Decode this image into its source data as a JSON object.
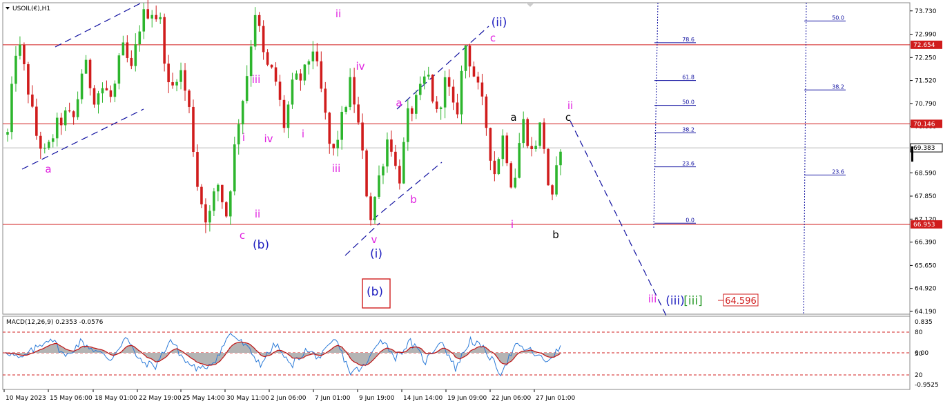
{
  "header": {
    "symbol_label": "USOIL(€),H1",
    "macd_label": "MACD(12,26,9) 0.2353 -0.0576"
  },
  "colors": {
    "bull": "#2db52d",
    "bear": "#d01c1c",
    "hline": "#d01c1c",
    "wave_magenta": "#e020e0",
    "wave_blue": "#2020c0",
    "wave_green": "#2a9a2a",
    "fib": "#1010a0",
    "macd_line": "#2a7ad8",
    "macd_signal": "#c01010",
    "macd_hist": "#b4b4b4"
  },
  "chart_data": [
    {
      "type": "candlestick",
      "title": "USOIL(€),H1",
      "x": [
        "10 May 2023",
        "15 May 06:00",
        "18 May 01:00",
        "22 May 19:00",
        "25 May 14:00",
        "30 May 11:00",
        "2 Jun 06:00",
        "7 Jun 01:00",
        "9 Jun 19:00",
        "14 Jun 14:00",
        "19 Jun 09:00",
        "22 Jun 06:00",
        "27 Jun 01:00"
      ],
      "ylim": [
        64.19,
        73.9
      ],
      "y_ticks": [
        "73.730",
        "72.990",
        "72.250",
        "71.520",
        "70.790",
        "70.060",
        "69.320",
        "68.590",
        "67.850",
        "67.120",
        "66.390",
        "65.650",
        "64.920",
        "64.190"
      ],
      "close_path": [
        69.8,
        72.9,
        71.5,
        69.8,
        69.1,
        70.0,
        70.4,
        70.3,
        72.2,
        71.0,
        71.3,
        70.9,
        72.6,
        71.8,
        73.5,
        73.8,
        73.4,
        71.0,
        72.0,
        70.7,
        68.0,
        67.0,
        68.3,
        67.2,
        69.9,
        71.5,
        73.8,
        72.0,
        71.7,
        70.1,
        71.5,
        71.6,
        72.6,
        71.0,
        69.0,
        70.2,
        71.5,
        69.7,
        67.1,
        68.5,
        69.9,
        68.2,
        70.4,
        70.9,
        71.8,
        70.4,
        71.6,
        70.2,
        72.7,
        71.6,
        70.5,
        68.5,
        69.8,
        68.0,
        70.3,
        69.2,
        70.2,
        67.4,
        69.5
      ],
      "horizontal_levels": [
        {
          "value": "72.654",
          "price": 72.654
        },
        {
          "value": "70.146",
          "price": 70.146
        },
        {
          "value": "66.953",
          "price": 66.953
        }
      ],
      "current_price": {
        "value": "69.383",
        "price": 69.383
      },
      "target": {
        "value": "64.596",
        "price": 64.596
      },
      "wave_labels": [
        {
          "text": "a",
          "color": "magenta"
        },
        {
          "text": "c",
          "color": "magenta"
        },
        {
          "text": "i",
          "color": "magenta"
        },
        {
          "text": "ii",
          "color": "magenta"
        },
        {
          "text": "iii",
          "color": "magenta"
        },
        {
          "text": "iv",
          "color": "magenta"
        },
        {
          "text": "(b)",
          "color": "blue"
        },
        {
          "text": "ii",
          "color": "magenta"
        },
        {
          "text": "i",
          "color": "magenta"
        },
        {
          "text": "iii",
          "color": "magenta"
        },
        {
          "text": "iv",
          "color": "magenta"
        },
        {
          "text": "v",
          "color": "magenta"
        },
        {
          "text": "(i)",
          "color": "blue"
        },
        {
          "text": "a",
          "color": "magenta"
        },
        {
          "text": "b",
          "color": "magenta"
        },
        {
          "text": "c",
          "color": "magenta"
        },
        {
          "text": "(ii)",
          "color": "blue"
        },
        {
          "text": "a",
          "color": "black"
        },
        {
          "text": "i",
          "color": "magenta"
        },
        {
          "text": "b",
          "color": "black"
        },
        {
          "text": "c",
          "color": "black"
        },
        {
          "text": "ii",
          "color": "magenta"
        },
        {
          "text": "iii",
          "color": "magenta"
        },
        {
          "text": "(iii)",
          "color": "blue"
        },
        {
          "text": "[iii]",
          "color": "green"
        },
        {
          "text": "(b)",
          "color": "blue",
          "boxed": true
        }
      ],
      "fib_left": [
        "78.6",
        "61.8",
        "50.0",
        "38.2",
        "23.6",
        "0.0"
      ],
      "fib_right": [
        "50.0",
        "38.2",
        "23.6"
      ]
    },
    {
      "type": "line",
      "title": "MACD(12,26,9) 0.2353 -0.0576",
      "y_ticks": [
        "0.835",
        "80",
        "0.00",
        "50",
        "20",
        "-0.9525"
      ],
      "macd_path": [
        0.1,
        -0.3,
        0.2,
        0.7,
        -0.2,
        0.5,
        0.1,
        -0.3,
        0.7,
        -0.4,
        -0.6,
        0.6,
        -0.4,
        -0.8,
        -0.3,
        0.9,
        0.3,
        -0.5,
        0.4,
        -0.6,
        0.1,
        -0.2,
        0.6,
        -0.9,
        -0.6,
        0.7,
        -0.2,
        0.5,
        -0.4,
        0.6,
        -0.7,
        0.6,
        0.1,
        -0.9,
        0.3,
        0.1,
        -0.4,
        0.2
      ],
      "series": []
    }
  ]
}
